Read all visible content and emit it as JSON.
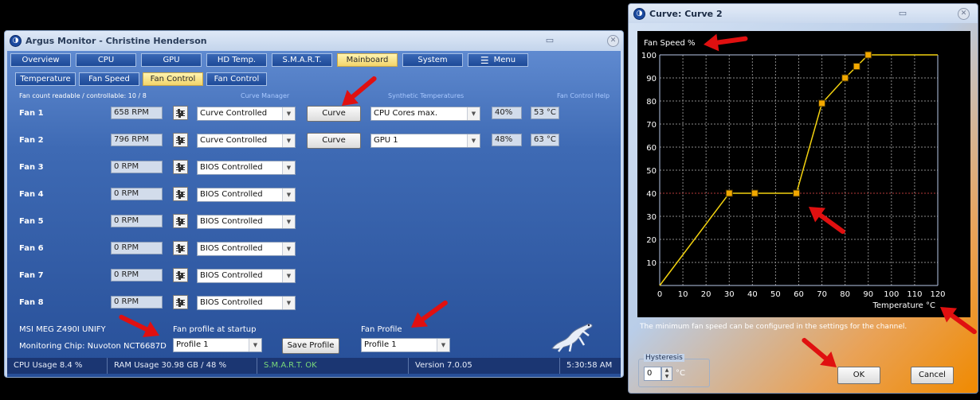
{
  "main_window": {
    "title": "Argus Monitor - Christine Henderson",
    "top_tabs": [
      "Overview",
      "CPU",
      "GPU",
      "HD Temp.",
      "S.M.A.R.T.",
      "Mainboard",
      "System",
      "Menu"
    ],
    "active_top_tab": "Mainboard",
    "sub_tabs": [
      "Temperature",
      "Fan Speed",
      "Fan Control",
      "Fan Control"
    ],
    "active_sub_tab": "Fan Control",
    "fan_count_text": "Fan count readable / controllable: 10 / 8",
    "curve_manager_label": "Curve Manager",
    "synthetic_temps_label": "Synthetic Temperatures",
    "help_label": "Fan Control Help",
    "fans": [
      {
        "name": "Fan 1",
        "rpm": "658 RPM",
        "mode": "Curve Controlled",
        "curve_button": "Curve",
        "source": "CPU Cores max.",
        "percent": "40%",
        "temp": "53 °C"
      },
      {
        "name": "Fan 2",
        "rpm": "796 RPM",
        "mode": "Curve Controlled",
        "curve_button": "Curve",
        "source": "GPU 1",
        "percent": "48%",
        "temp": "63 °C"
      },
      {
        "name": "Fan 3",
        "rpm": "0 RPM",
        "mode": "BIOS Controlled"
      },
      {
        "name": "Fan 4",
        "rpm": "0 RPM",
        "mode": "BIOS Controlled"
      },
      {
        "name": "Fan 5",
        "rpm": "0 RPM",
        "mode": "BIOS Controlled"
      },
      {
        "name": "Fan 6",
        "rpm": "0 RPM",
        "mode": "BIOS Controlled"
      },
      {
        "name": "Fan 7",
        "rpm": "0 RPM",
        "mode": "BIOS Controlled"
      },
      {
        "name": "Fan 8",
        "rpm": "0 RPM",
        "mode": "BIOS Controlled"
      }
    ],
    "board_name": "MSI MEG Z490I UNIFY",
    "chip_text": "Monitoring Chip: Nuvoton NCT6687D",
    "startup_profile_label": "Fan profile at startup",
    "startup_profile_value": "Profile 1",
    "save_profile_label": "Save Profile",
    "fan_profile_label": "Fan Profile",
    "fan_profile_value": "Profile 1",
    "status": {
      "cpu_usage": "CPU Usage 8.4 %",
      "ram_usage": "RAM Usage 30.98 GB / 48 %",
      "smart": "S.M.A.R.T. OK",
      "version": "Version 7.0.05",
      "time": "5:30:58 AM"
    }
  },
  "curve_window": {
    "title": "Curve: Curve 2",
    "info_text": "The minimum fan speed can be configured in the settings for the channel.",
    "hysteresis_label": "Hysteresis",
    "hysteresis_value": "0",
    "hysteresis_unit": "°C",
    "ok_label": "OK",
    "cancel_label": "Cancel"
  },
  "chart_data": {
    "type": "line",
    "ylabel": "Fan Speed %",
    "xlabel": "Temperature °C",
    "xlim": [
      0,
      120
    ],
    "ylim": [
      0,
      100
    ],
    "xticks": [
      0,
      10,
      20,
      30,
      40,
      50,
      60,
      70,
      80,
      90,
      100,
      110,
      120
    ],
    "yticks": [
      10,
      20,
      30,
      40,
      50,
      60,
      70,
      80,
      90,
      100
    ],
    "line_color": "#f2d10f",
    "grid": true,
    "reference_line_y": 40,
    "points": [
      [
        0,
        0
      ],
      [
        30,
        40
      ],
      [
        41,
        40
      ],
      [
        59,
        40
      ],
      [
        70,
        79
      ],
      [
        80,
        90
      ],
      [
        85,
        95
      ],
      [
        90,
        100
      ],
      [
        120,
        100
      ]
    ],
    "markers": [
      [
        30,
        40
      ],
      [
        41,
        40
      ],
      [
        59,
        40
      ],
      [
        70,
        79
      ],
      [
        80,
        90
      ],
      [
        85,
        95
      ],
      [
        90,
        100
      ]
    ]
  },
  "colors": {
    "accent_active_tab": "#f2d46a",
    "panel_blue": "#274f98",
    "curve_line": "#f2d10f",
    "annotation_arrow": "#e01010",
    "smart_ok": "#7ad97a"
  }
}
